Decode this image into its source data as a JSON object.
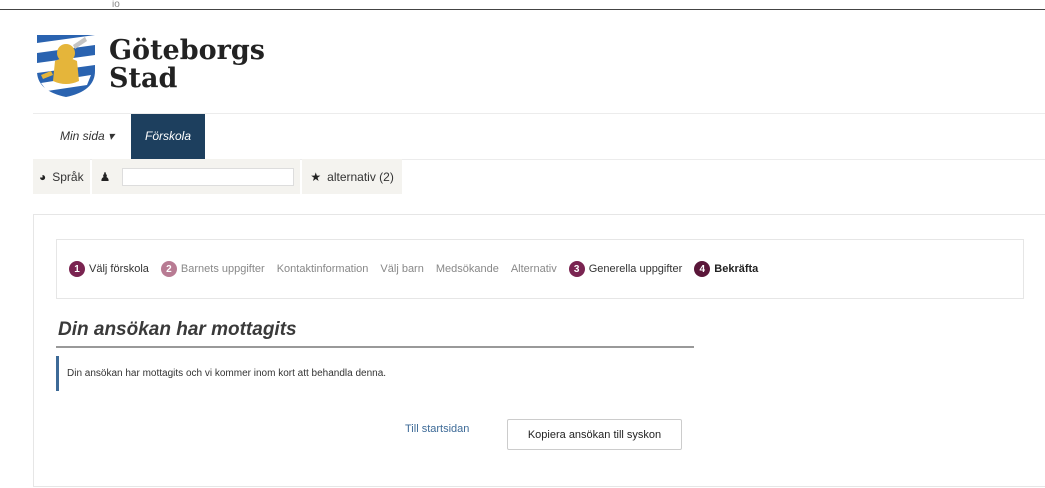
{
  "top_mark": "io",
  "brand": {
    "line1": "Göteborgs",
    "line2": "Stad"
  },
  "nav": {
    "min_sida": "Min sida ▾",
    "forskola": "Förskola"
  },
  "toolbar": {
    "sprak": "Språk",
    "alternativ": "alternativ (2)"
  },
  "steps": [
    {
      "num": "1",
      "label": "Välj förskola"
    },
    {
      "num": "2",
      "label": "Barnets uppgifter"
    },
    {
      "num": "",
      "label": "Kontaktinformation"
    },
    {
      "num": "",
      "label": "Välj barn"
    },
    {
      "num": "",
      "label": "Medsökande"
    },
    {
      "num": "",
      "label": "Alternativ"
    },
    {
      "num": "3",
      "label": "Generella uppgifter"
    },
    {
      "num": "4",
      "label": "Bekräfta"
    }
  ],
  "main": {
    "heading": "Din ansökan har mottagits",
    "notice": "Din ansökan har mottagits och vi kommer inom kort att behandla denna.",
    "link_start": "Till startsidan",
    "copy_button": "Kopiera ansökan till syskon"
  },
  "colors": {
    "nav_active": "#1d3f5e",
    "step_active": "#7a2451",
    "step_done": "#b87b93",
    "link": "#3d6a97"
  }
}
